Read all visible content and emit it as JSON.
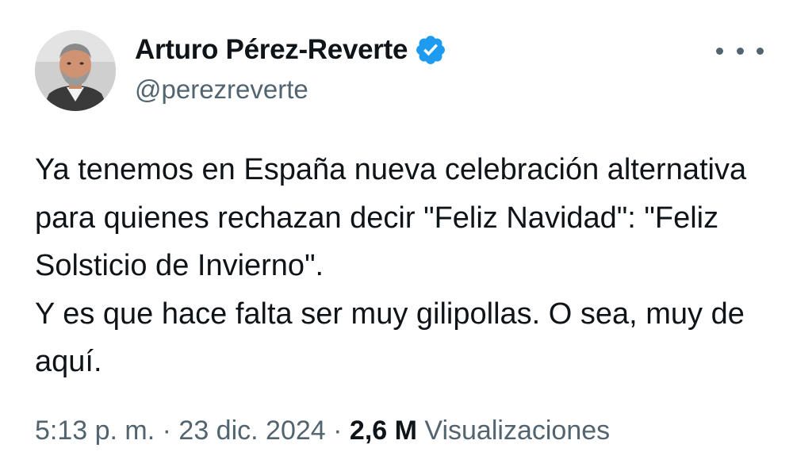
{
  "author": {
    "name": "Arturo Pérez-Reverte",
    "handle": "@perezreverte",
    "verified_color": "#1d9bf0"
  },
  "tweet": {
    "paragraph1": "Ya tenemos en España nueva celebración alternativa para quienes rechazan decir \"Feliz Navidad\": \"Feliz Solsticio de Invierno\".",
    "paragraph2": "Y es que hace falta ser muy gilipollas. O sea, muy de aquí."
  },
  "meta": {
    "time": "5:13 p. m.",
    "sep1": " · ",
    "date": "23 dic. 2024",
    "sep2": " · ",
    "views_count": "2,6 M",
    "views_label": " Visualizaciones"
  },
  "icons": {
    "more": "more-horizontal-icon",
    "verified": "verified-badge-icon"
  }
}
